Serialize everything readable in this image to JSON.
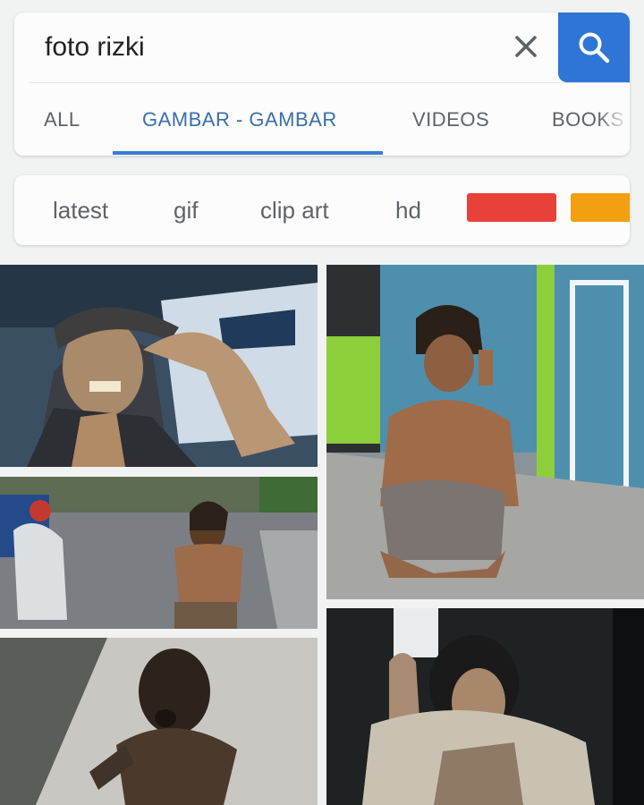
{
  "search": {
    "query": "foto rizki",
    "clear_icon": "close-icon",
    "search_icon": "search-icon",
    "search_button_color": "#2f75d6"
  },
  "tabs": [
    {
      "label": "ALL",
      "active": false
    },
    {
      "label": "GAMBAR - GAMBAR",
      "active": true
    },
    {
      "label": "VIDEOS",
      "active": false
    },
    {
      "label": "BOOKS",
      "active": false
    }
  ],
  "filters": {
    "chips": [
      "latest",
      "gif",
      "clip art",
      "hd"
    ],
    "color_chips": [
      "#e8413a",
      "#f2a00f"
    ]
  },
  "results": [
    {
      "id": "result-1",
      "description": "man with cap smiling"
    },
    {
      "id": "result-2",
      "description": "man squatting smoking"
    },
    {
      "id": "result-3",
      "description": "shirtless man on road"
    },
    {
      "id": "result-4",
      "description": "dirty child"
    },
    {
      "id": "result-5",
      "description": "woman in dark room"
    }
  ]
}
